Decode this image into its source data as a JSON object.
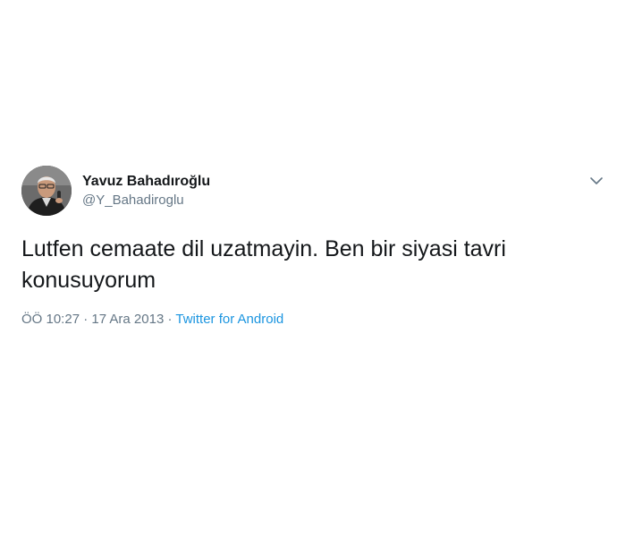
{
  "tweet": {
    "display_name": "Yavuz Bahadıroğlu",
    "handle": "@Y_Bahadiroglu",
    "text": "Lutfen cemaate dil uzatmayin. Ben bir siyasi tavri konusuyorum",
    "time": "ÖÖ 10:27",
    "separator_1": " · ",
    "date": "17 Ara 2013",
    "separator_2": " · ",
    "source": "Twitter for Android",
    "menu_icon": "chevron-down-icon",
    "avatar_icon": "avatar-photo"
  },
  "colors": {
    "text": "#14171a",
    "secondary": "#657786",
    "link": "#1b95e0",
    "background": "#ffffff"
  }
}
